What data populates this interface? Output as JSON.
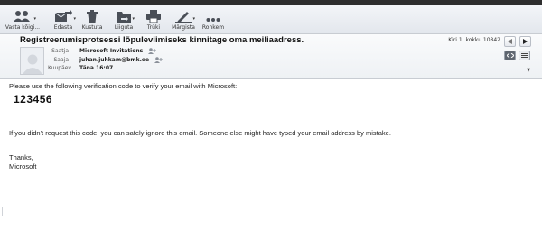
{
  "toolbar": {
    "buttons": [
      {
        "label": "Vasta kõigi...",
        "icon": "reply-all-icon",
        "dropdown": true
      },
      {
        "label": "Edasta",
        "icon": "forward-icon",
        "dropdown": true
      },
      {
        "label": "Kustuta",
        "icon": "trash-icon",
        "dropdown": false
      },
      {
        "label": "Liiguta",
        "icon": "folder-move-icon",
        "dropdown": true
      },
      {
        "label": "Trüki",
        "icon": "printer-icon",
        "dropdown": false
      },
      {
        "label": "Märgista",
        "icon": "pencil-icon",
        "dropdown": true
      },
      {
        "label": "Rohkem",
        "icon": "more-dots-icon",
        "dropdown": false
      }
    ]
  },
  "header": {
    "subject": "Registreerumisprotsessi lõpuleviimiseks kinnitage oma meiliaadress.",
    "from_label": "Saatja",
    "from_value": "Microsoft Invitations",
    "to_label": "Saaja",
    "to_value": "juhan.juhkam@bmk.ee",
    "date_label": "Kuupäev",
    "date_value": "Täna 16:07",
    "message_count": "Kiri 1, kokku 10842"
  },
  "body": {
    "intro": "Please use the following verification code to verify your email with Microsoft:",
    "code": "123456",
    "note": "If you didn't request this code, you can safely ignore this email. Someone else might have typed your email address by mistake.",
    "thanks": "Thanks,",
    "signature": "Microsoft"
  },
  "colors": {
    "toolbar_icon": "#4a4f57",
    "topstrip": "#2e2e2e",
    "active_view": "#5f6670"
  }
}
